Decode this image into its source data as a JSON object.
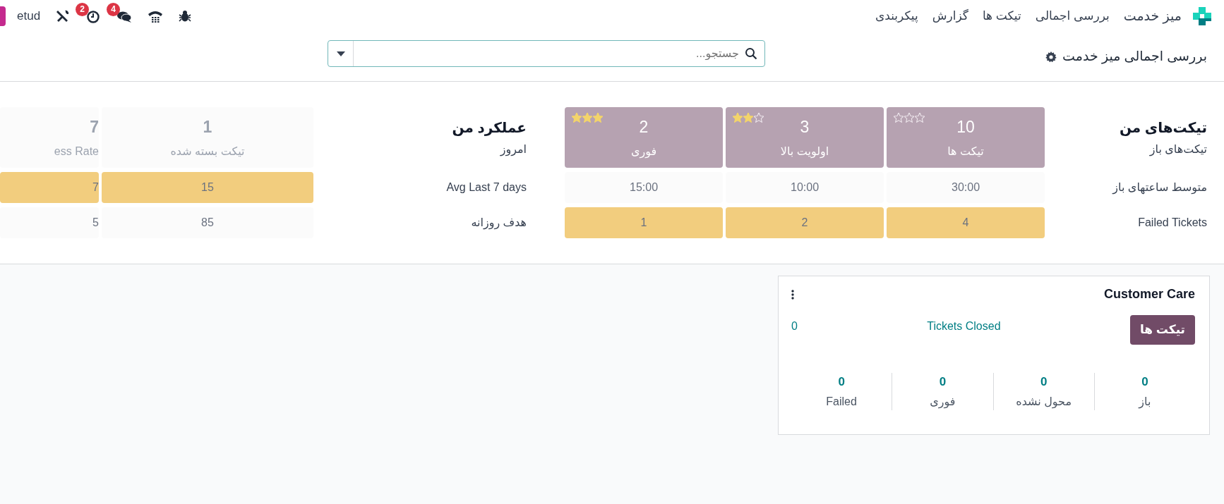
{
  "navbar": {
    "app_name": "میز خدمت",
    "menu": [
      "بررسی اجمالی",
      "تیکت ها",
      "گزارش",
      "پیکربندی"
    ],
    "company": "etud",
    "activity_count": "2",
    "message_count": "4"
  },
  "control_panel": {
    "breadcrumb": "بررسی اجمالی میز خدمت",
    "search": {
      "placeholder": "جستجو..."
    }
  },
  "my_tickets": {
    "title": "تیکت‌های من",
    "header_label": "تیکت‌های باز",
    "cells": [
      {
        "value": "10",
        "label": "تیکت ها",
        "stars": 0
      },
      {
        "value": "3",
        "label": "اولویت بالا",
        "stars": 2
      },
      {
        "value": "2",
        "label": "فوری",
        "stars": 3
      }
    ],
    "rows": [
      {
        "label": "متوسط ساعتهای باز",
        "highlighted": false,
        "values": [
          "30:00",
          "10:00",
          "15:00"
        ]
      },
      {
        "label": "Failed Tickets",
        "highlighted": true,
        "values": [
          "4",
          "2",
          "1"
        ]
      }
    ]
  },
  "my_performance": {
    "title": "عملکرد من",
    "header_label": "امروز",
    "cells": [
      {
        "value": "1",
        "label": "تیکت بسته شده"
      },
      {
        "value": "7",
        "label": "ess Rate"
      }
    ],
    "rows": [
      {
        "label": "Avg Last 7 days",
        "highlighted": true,
        "values": [
          "15",
          "7"
        ]
      },
      {
        "label": "هدف روزانه",
        "highlighted": false,
        "values": [
          "85",
          "5"
        ]
      }
    ]
  },
  "team": {
    "title": "Customer Care",
    "button": "تیکت ها",
    "closed_label": "Tickets Closed",
    "closed_value": "0",
    "stats": [
      {
        "value": "0",
        "label": "باز"
      },
      {
        "value": "0",
        "label": "محول نشده"
      },
      {
        "value": "0",
        "label": "فوری"
      },
      {
        "value": "0",
        "label": "Failed"
      }
    ]
  }
}
